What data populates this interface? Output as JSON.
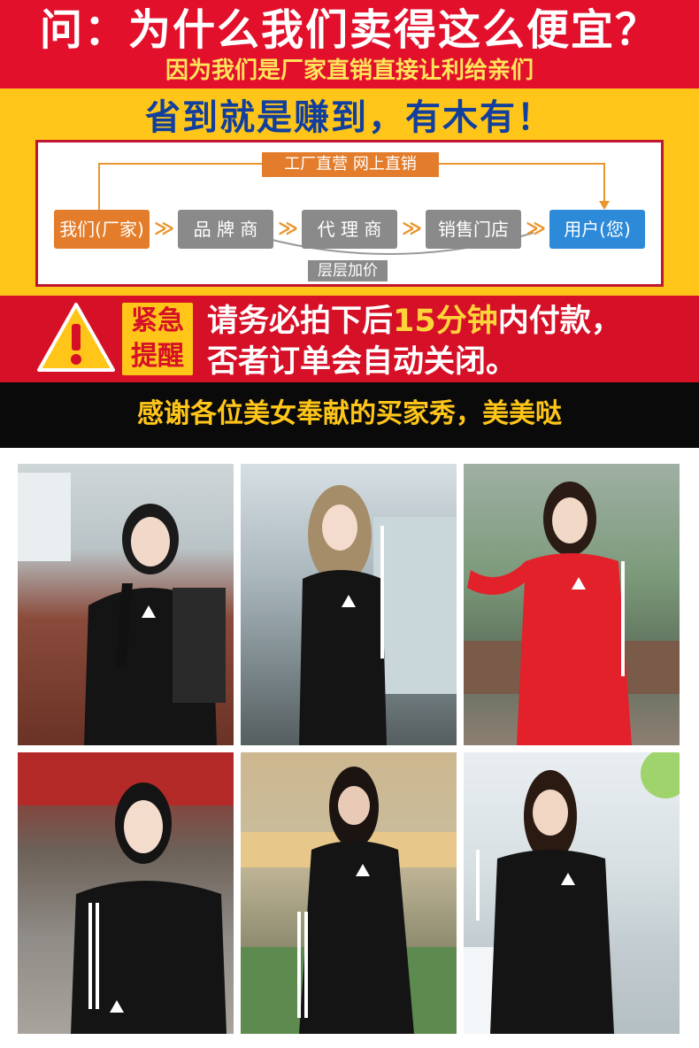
{
  "header": {
    "question": "问：为什么我们卖得这么便宜？",
    "answer": "因为我们是厂家直销直接让利给亲们"
  },
  "slogan": "省到就是赚到，有木有！",
  "flow": {
    "direct_label": "工厂直营 网上直销",
    "markup_label": "层层加价",
    "nodes": [
      "我们(厂家)",
      "品 牌 商",
      "代 理 商",
      "销售门店",
      "用户(您)"
    ]
  },
  "reminder": {
    "badge_line1": "紧急",
    "badge_line2": "提醒",
    "line1_prefix": "请务必拍下后",
    "line1_highlight": "15分钟",
    "line1_suffix": "内付款，",
    "line2": "否者订单会自动关闭。"
  },
  "thanks": "感谢各位美女奉献的买家秀，美美哒",
  "colors": {
    "banner_red": "#e3102b",
    "yellow": "#ffc619",
    "navy": "#123e9d",
    "reminder_red": "#d51027",
    "highlight_yellow": "#ffd43a"
  },
  "photos": [
    {
      "outfit": "black"
    },
    {
      "outfit": "black"
    },
    {
      "outfit": "red"
    },
    {
      "outfit": "black"
    },
    {
      "outfit": "black"
    },
    {
      "outfit": "black"
    }
  ]
}
